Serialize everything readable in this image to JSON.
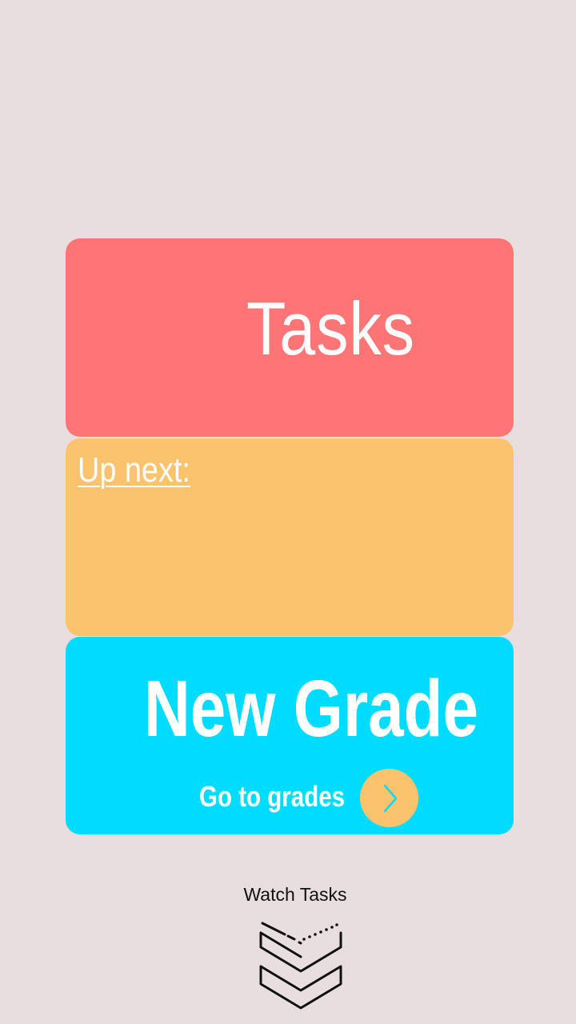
{
  "tasks_card": {
    "title": "Tasks",
    "color": "#ff7575"
  },
  "up_next_card": {
    "label": "Up next:",
    "color": "#fbc36d"
  },
  "grade_card": {
    "headline": "New Grade",
    "link_label": "Go to grades",
    "color": "#00dcff",
    "button_icon": "chevron-right-icon"
  },
  "footer": {
    "label": "Watch Tasks",
    "logo_icon": "stacked-chevrons-logo-icon"
  }
}
